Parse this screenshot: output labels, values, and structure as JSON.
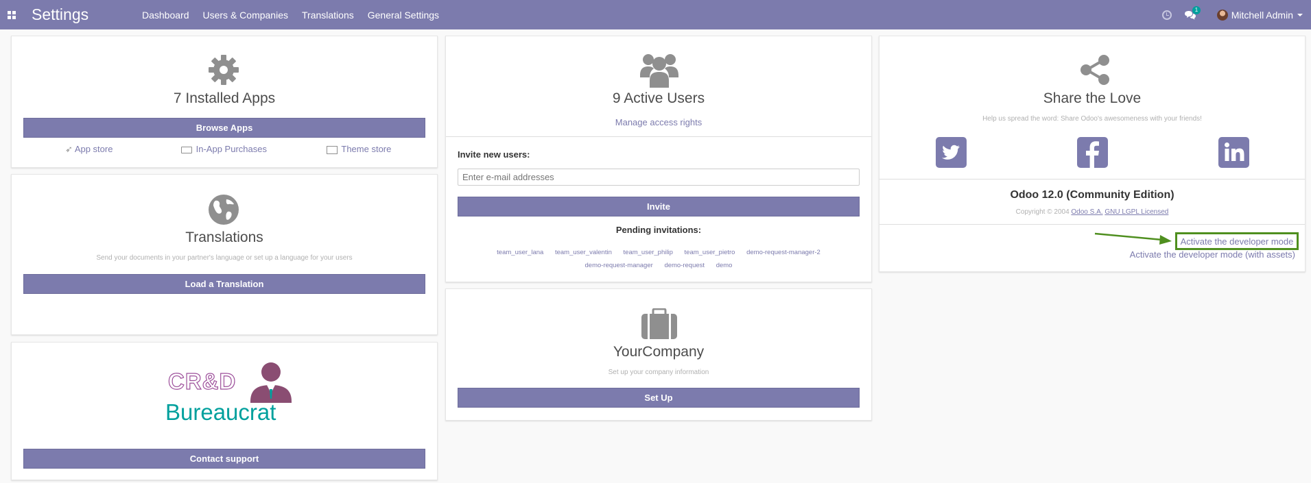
{
  "navbar": {
    "app_title": "Settings",
    "menu": [
      "Dashboard",
      "Users & Companies",
      "Translations",
      "General Settings"
    ],
    "chat_badge": "1",
    "user_name": "Mitchell Admin"
  },
  "apps_card": {
    "title": "7 Installed Apps",
    "button": "Browse Apps",
    "links": [
      "App store",
      "In-App Purchases",
      "Theme store"
    ]
  },
  "translations_card": {
    "title": "Translations",
    "subtitle": "Send your documents in your partner's language or set up a language for your users",
    "button": "Load a Translation"
  },
  "support_card": {
    "logo_text_top": "CR&D",
    "logo_text_bottom": "Bureaucrat",
    "button": "Contact support"
  },
  "users_card": {
    "title": "9 Active Users",
    "manage_link": "Manage access rights",
    "invite_label": "Invite new users:",
    "email_placeholder": "Enter e-mail addresses",
    "invite_button": "Invite",
    "pending_label": "Pending invitations:",
    "pending": [
      "team_user_lana",
      "team_user_valentin",
      "team_user_philip",
      "team_user_pietro",
      "demo-request-manager-2",
      "demo-request-manager",
      "demo-request",
      "demo"
    ]
  },
  "company_card": {
    "title": "YourCompany",
    "subtitle": "Set up your company information",
    "button": "Set Up"
  },
  "share_card": {
    "title": "Share the Love",
    "subtitle": "Help us spread the word: Share Odoo's awesomeness with your friends!",
    "version": "Odoo 12.0 (Community Edition)",
    "copyright": "Copyright © 2004",
    "odoo_link": "Odoo S.A.",
    "license_link": "GNU LGPL Licensed",
    "dev_mode": "Activate the developer mode",
    "dev_mode_assets": "Activate the developer mode (with assets)"
  },
  "colors": {
    "primary": "#7c7bad",
    "highlight": "#4f8f1f",
    "teal": "#00a09d"
  }
}
